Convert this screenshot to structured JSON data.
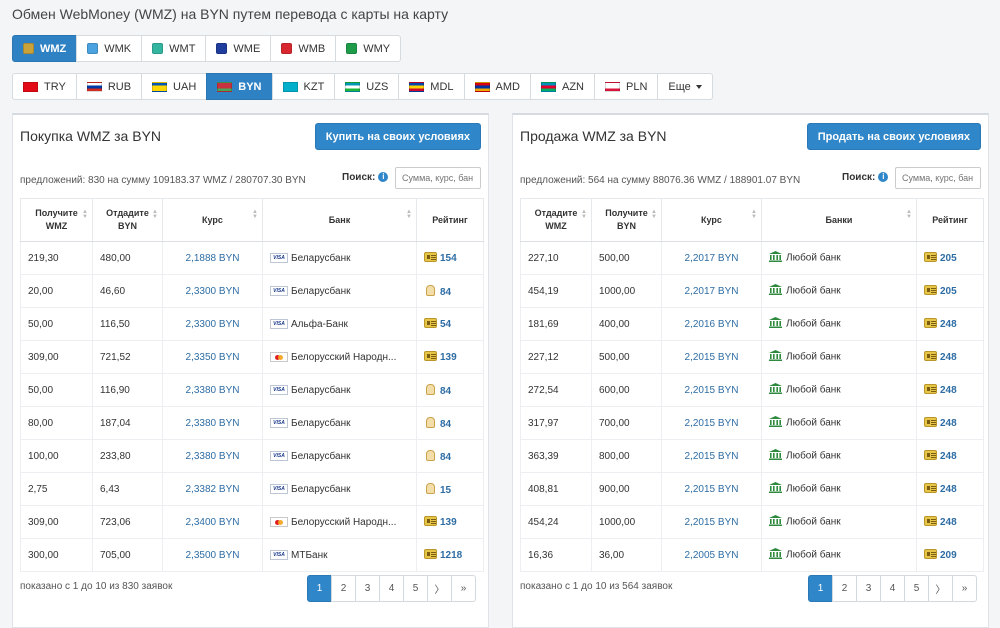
{
  "page_title": "Обмен WebMoney (WMZ) на BYN путем перевода с карты на карту",
  "purse_tabs": [
    {
      "label": "WMZ",
      "active": true,
      "icon_color": "#c9a23a"
    },
    {
      "label": "WMK",
      "active": false,
      "icon_color": "#4aa3df"
    },
    {
      "label": "WMT",
      "active": false,
      "icon_color": "#33b5a0"
    },
    {
      "label": "WME",
      "active": false,
      "icon_color": "#1f3d9c"
    },
    {
      "label": "WMB",
      "active": false,
      "icon_color": "#d8272f"
    },
    {
      "label": "WMY",
      "active": false,
      "icon_color": "#1e9c4a"
    }
  ],
  "currency_tabs": [
    {
      "label": "TRY",
      "active": false,
      "flag": [
        "#e30a17",
        "#e30a17",
        "#e30a17"
      ]
    },
    {
      "label": "RUB",
      "active": false,
      "flag": [
        "#ffffff",
        "#0039a6",
        "#d52b1e"
      ]
    },
    {
      "label": "UAH",
      "active": false,
      "flag": [
        "#0057b7",
        "#ffd700",
        "#ffd700"
      ]
    },
    {
      "label": "BYN",
      "active": true,
      "flag": [
        "#c8313e",
        "#c8313e",
        "#4aa657"
      ]
    },
    {
      "label": "KZT",
      "active": false,
      "flag": [
        "#00afca",
        "#00afca",
        "#00afca"
      ]
    },
    {
      "label": "UZS",
      "active": false,
      "flag": [
        "#0099b5",
        "#ffffff",
        "#1eb53a"
      ]
    },
    {
      "label": "MDL",
      "active": false,
      "flag": [
        "#0046ae",
        "#ffd200",
        "#cc092f"
      ]
    },
    {
      "label": "AMD",
      "active": false,
      "flag": [
        "#d90012",
        "#0033a0",
        "#f2a800"
      ]
    },
    {
      "label": "AZN",
      "active": false,
      "flag": [
        "#0092bc",
        "#e4002b",
        "#00af66"
      ]
    },
    {
      "label": "PLN",
      "active": false,
      "flag": [
        "#ffffff",
        "#ffffff",
        "#dc143c"
      ]
    }
  ],
  "more_label": "Еще",
  "buy": {
    "title": "Покупка WMZ за BYN",
    "action_label": "Купить на своих условиях",
    "summary": "предложений: 830 на сумму 109183.37 WMZ / 280707.30 BYN",
    "search_label": "Поиск:",
    "search_placeholder": "Сумма, курс, бан",
    "headers": [
      "Получите WMZ",
      "Отдадите BYN",
      "Курс",
      "Банк",
      "Рейтинг"
    ],
    "rows": [
      {
        "c1": "219,30",
        "c2": "480,00",
        "rate": "2,1888 BYN",
        "bank": "Беларусбанк",
        "card": "visa",
        "badge": "personal",
        "rating": "154"
      },
      {
        "c1": "20,00",
        "c2": "46,60",
        "rate": "2,3300 BYN",
        "bank": "Беларусбанк",
        "card": "visa",
        "badge": "formal",
        "rating": "84"
      },
      {
        "c1": "50,00",
        "c2": "116,50",
        "rate": "2,3300 BYN",
        "bank": "Альфа-Банк",
        "card": "visa",
        "badge": "personal",
        "rating": "54"
      },
      {
        "c1": "309,00",
        "c2": "721,52",
        "rate": "2,3350 BYN",
        "bank": "Белорусский Народн...",
        "card": "mastercard",
        "badge": "personal",
        "rating": "139"
      },
      {
        "c1": "50,00",
        "c2": "116,90",
        "rate": "2,3380 BYN",
        "bank": "Беларусбанк",
        "card": "visa",
        "badge": "formal",
        "rating": "84"
      },
      {
        "c1": "80,00",
        "c2": "187,04",
        "rate": "2,3380 BYN",
        "bank": "Беларусбанк",
        "card": "visa",
        "badge": "formal",
        "rating": "84"
      },
      {
        "c1": "100,00",
        "c2": "233,80",
        "rate": "2,3380 BYN",
        "bank": "Беларусбанк",
        "card": "visa",
        "badge": "formal",
        "rating": "84"
      },
      {
        "c1": "2,75",
        "c2": "6,43",
        "rate": "2,3382 BYN",
        "bank": "Беларусбанк",
        "card": "visa",
        "badge": "formal",
        "rating": "15"
      },
      {
        "c1": "309,00",
        "c2": "723,06",
        "rate": "2,3400 BYN",
        "bank": "Белорусский Народн...",
        "card": "mastercard",
        "badge": "personal",
        "rating": "139"
      },
      {
        "c1": "300,00",
        "c2": "705,00",
        "rate": "2,3500 BYN",
        "bank": "МТБанк",
        "card": "visa",
        "badge": "personal",
        "rating": "1218"
      }
    ],
    "footer": "показано с 1 до 10 из 830 заявок",
    "pages": [
      "1",
      "2",
      "3",
      "4",
      "5",
      "〉",
      "»"
    ]
  },
  "sell": {
    "title": "Продажа WMZ за BYN",
    "action_label": "Продать на своих условиях",
    "summary": "предложений: 564 на сумму 88076.36 WMZ / 188901.07 BYN",
    "search_label": "Поиск:",
    "search_placeholder": "Сумма, курс, бан",
    "headers": [
      "Отдадите WMZ",
      "Получите BYN",
      "Курс",
      "Банки",
      "Рейтинг"
    ],
    "rows": [
      {
        "c1": "227,10",
        "c2": "500,00",
        "rate": "2,2017 BYN",
        "bank": "Любой банк",
        "badge": "personal",
        "rating": "205"
      },
      {
        "c1": "454,19",
        "c2": "1000,00",
        "rate": "2,2017 BYN",
        "bank": "Любой банк",
        "badge": "personal",
        "rating": "205"
      },
      {
        "c1": "181,69",
        "c2": "400,00",
        "rate": "2,2016 BYN",
        "bank": "Любой банк",
        "badge": "personal",
        "rating": "248"
      },
      {
        "c1": "227,12",
        "c2": "500,00",
        "rate": "2,2015 BYN",
        "bank": "Любой банк",
        "badge": "personal",
        "rating": "248"
      },
      {
        "c1": "272,54",
        "c2": "600,00",
        "rate": "2,2015 BYN",
        "bank": "Любой банк",
        "badge": "personal",
        "rating": "248"
      },
      {
        "c1": "317,97",
        "c2": "700,00",
        "rate": "2,2015 BYN",
        "bank": "Любой банк",
        "badge": "personal",
        "rating": "248"
      },
      {
        "c1": "363,39",
        "c2": "800,00",
        "rate": "2,2015 BYN",
        "bank": "Любой банк",
        "badge": "personal",
        "rating": "248"
      },
      {
        "c1": "408,81",
        "c2": "900,00",
        "rate": "2,2015 BYN",
        "bank": "Любой банк",
        "badge": "personal",
        "rating": "248"
      },
      {
        "c1": "454,24",
        "c2": "1000,00",
        "rate": "2,2015 BYN",
        "bank": "Любой банк",
        "badge": "personal",
        "rating": "248"
      },
      {
        "c1": "16,36",
        "c2": "36,00",
        "rate": "2,2005 BYN",
        "bank": "Любой банк",
        "badge": "personal",
        "rating": "209"
      }
    ],
    "footer": "показано с 1 до 10 из 564 заявок",
    "pages": [
      "1",
      "2",
      "3",
      "4",
      "5",
      "〉",
      "»"
    ]
  },
  "colors": {
    "accent": "#2f86c8",
    "link": "#2e6da4",
    "bank_icon": "#2d8a3e"
  }
}
